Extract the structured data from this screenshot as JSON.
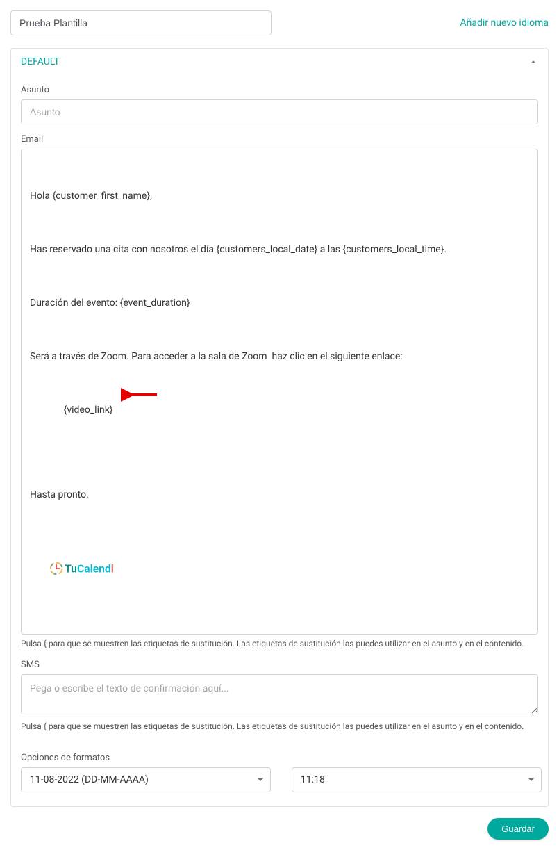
{
  "header": {
    "template_name": "Prueba Plantilla",
    "add_language": "Añadir nuevo idioma"
  },
  "panel": {
    "title": "DEFAULT"
  },
  "subject": {
    "label": "Asunto",
    "placeholder": "Asunto",
    "value": ""
  },
  "email": {
    "label": "Email",
    "body": {
      "line1": "Hola {customer_first_name},",
      "line2": "Has reservado una cita con nosotros el día {customers_local_date} a las {customers_local_time}.",
      "line3": "Duración del evento: {event_duration}",
      "line4": "Será a través de Zoom. Para acceder a la sala de Zoom  haz clic en el siguiente enlace:",
      "line5": "{video_link}",
      "line6": "Hasta pronto."
    },
    "logo": {
      "part1": "Tu",
      "part2": "Calend",
      "part3": "i"
    },
    "hint": "Pulsa { para que se muestren las etiquetas de sustitución. Las etiquetas de sustitución las puedes utilizar en el asunto y en el contenido."
  },
  "sms": {
    "label": "SMS",
    "placeholder": "Pega o escribe el texto de confirmación aquí...",
    "value": "",
    "hint": "Pulsa { para que se muestren las etiquetas de sustitución. Las etiquetas de sustitución las puedes utilizar en el asunto y en el contenido."
  },
  "format": {
    "label": "Opciones de formatos",
    "date_value": "11-08-2022 (DD-MM-AAAA)",
    "time_value": "11:18"
  },
  "footer": {
    "save": "Guardar"
  }
}
